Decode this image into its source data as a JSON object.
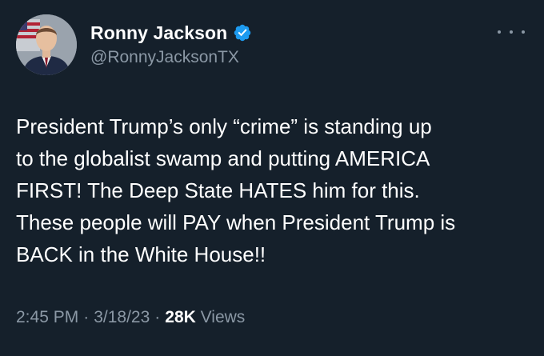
{
  "author": {
    "display_name": "Ronny Jackson",
    "handle": "@RonnyJacksonTX",
    "verified_icon": "verified-badge-icon",
    "avatar_icon": "profile-photo"
  },
  "tweet": {
    "lines": [
      "President Trump’s only “crime” is standing up",
      "to the globalist swamp and putting AMERICA",
      "FIRST! The Deep State HATES him for this.",
      "These people will PAY when President Trump is",
      "BACK in the White House!!"
    ]
  },
  "meta": {
    "time": "2:45 PM",
    "separator": "·",
    "date": "3/18/23",
    "views_count": "28K",
    "views_label": "Views"
  },
  "colors": {
    "background": "#15202b",
    "text": "#ffffff",
    "muted": "#8b98a5",
    "verified": "#1d9bf0"
  },
  "menu": {
    "icon": "more-options-icon"
  }
}
